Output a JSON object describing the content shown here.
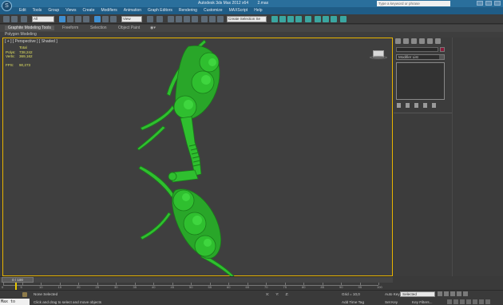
{
  "app": {
    "title": "Autodesk 3ds Max 2012 x64",
    "file": "2.max",
    "search_placeholder": "Type a keyword or phrase",
    "logo_letter": "S"
  },
  "menu": [
    "Edit",
    "Tools",
    "Group",
    "Views",
    "Create",
    "Modifiers",
    "Animation",
    "Graph Editors",
    "Rendering",
    "Customize",
    "MAXScript",
    "Help"
  ],
  "toolbar": {
    "filter_dropdown": "All",
    "coord_dropdown": "View",
    "selection_set": "Create Selection Se"
  },
  "ribbon": {
    "tabs": [
      "Graphite Modeling Tools",
      "Freeform",
      "Selection",
      "Object Paint"
    ],
    "active_tab": "Graphite Modeling Tools",
    "sub_label": "Polygon Modeling"
  },
  "viewport": {
    "label": "[ + ] [ Perspective ] [ Shaded ]",
    "stats_header": "Total",
    "polys_label": "Polys:",
    "polys_value": "738,242",
    "verts_label": "Verts:",
    "verts_value": "369,162",
    "fps_label": "FPS:",
    "fps_value": "90,273",
    "model_color": "#2fbf2f",
    "border_color": "#e8b400"
  },
  "command_panel": {
    "modifier_list": "Modifier List",
    "object_color": "#8b1a3a"
  },
  "timeline": {
    "slider_text": "0 / 100",
    "ticks": [
      "0",
      "5",
      "10",
      "15",
      "20",
      "25",
      "30",
      "35",
      "40",
      "45",
      "50",
      "55",
      "60",
      "65",
      "70",
      "75",
      "80",
      "85",
      "90",
      "95",
      "100"
    ]
  },
  "status": {
    "maxscript": "Max to Physc",
    "selection_info": "None Selected",
    "hint": "Click and drag to select and move objects",
    "x_label": "X:",
    "y_label": "Y:",
    "z_label": "Z:",
    "grid": "Grid = 10,0",
    "add_time_tag": "Add Time Tag",
    "auto_key": "Auto Key",
    "set_key": "Set Key",
    "selected_dropdown": "Selected",
    "key_filters": "Key Filters..."
  }
}
